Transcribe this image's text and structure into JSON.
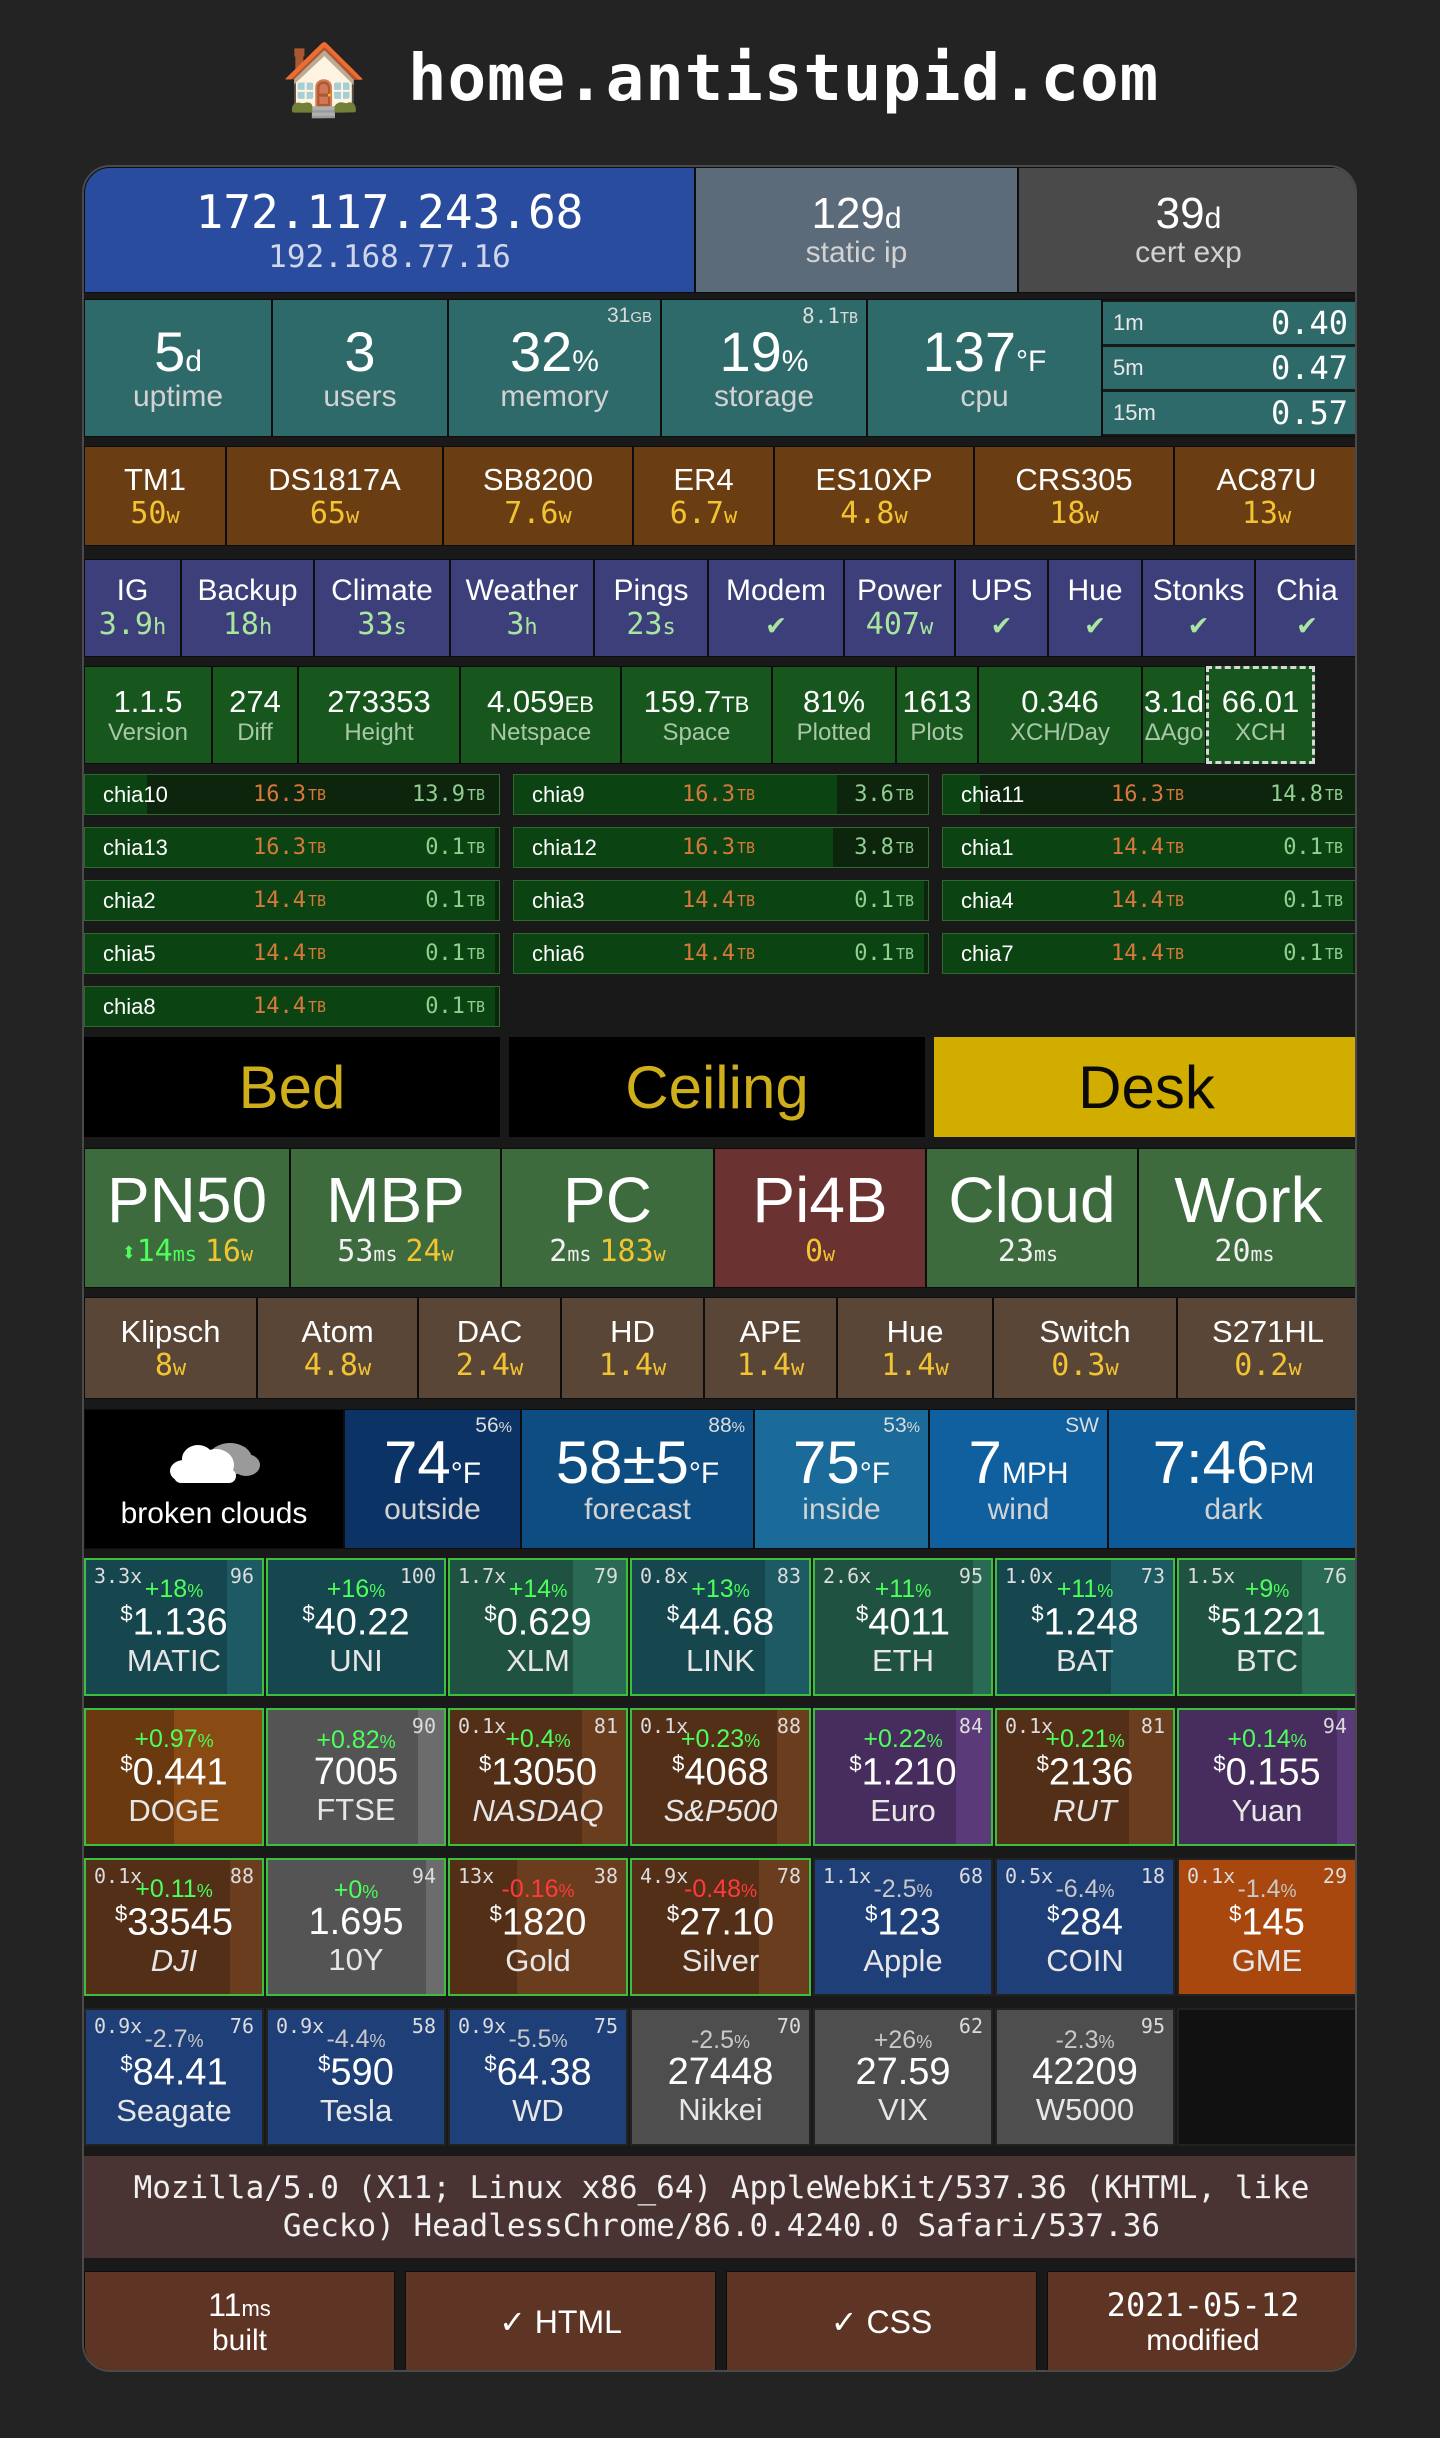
{
  "header": {
    "icon": "🏠",
    "site": "home.antistupid.com"
  },
  "network": {
    "ip_public": "172.117.243.68",
    "ip_local": "192.168.77.16",
    "static_days": "129",
    "static_unit": "d",
    "static_label": "static ip",
    "cert_days": "39",
    "cert_unit": "d",
    "cert_label": "cert exp"
  },
  "system": {
    "uptime": {
      "value": "5",
      "unit": "d",
      "label": "uptime"
    },
    "users": {
      "value": "3",
      "label": "users"
    },
    "memory": {
      "value": "32",
      "unit": "%",
      "label": "memory",
      "corner": "31",
      "corner_unit": "GB"
    },
    "storage": {
      "value": "19",
      "unit": "%",
      "label": "storage",
      "corner": "8.1",
      "corner_unit": "TB"
    },
    "cpu": {
      "value": "137",
      "unit": "°F",
      "label": "cpu"
    },
    "load": [
      {
        "period": "1m",
        "value": "0.40"
      },
      {
        "period": "5m",
        "value": "0.47"
      },
      {
        "period": "15m",
        "value": "0.57"
      }
    ]
  },
  "devices": [
    {
      "name": "TM1",
      "power": "50",
      "unit": "w"
    },
    {
      "name": "DS1817A",
      "power": "65",
      "unit": "w"
    },
    {
      "name": "SB8200",
      "power": "7.6",
      "unit": "w"
    },
    {
      "name": "ER4",
      "power": "6.7",
      "unit": "w"
    },
    {
      "name": "ES10XP",
      "power": "4.8",
      "unit": "w"
    },
    {
      "name": "CRS305",
      "power": "18",
      "unit": "w"
    },
    {
      "name": "AC87U",
      "power": "13",
      "unit": "w"
    }
  ],
  "services": [
    {
      "name": "IG",
      "value": "3.9",
      "unit": "h"
    },
    {
      "name": "Backup",
      "value": "18",
      "unit": "h"
    },
    {
      "name": "Climate",
      "value": "33",
      "unit": "s"
    },
    {
      "name": "Weather",
      "value": "3",
      "unit": "h"
    },
    {
      "name": "Pings",
      "value": "23",
      "unit": "s"
    },
    {
      "name": "Modem",
      "value": "✔",
      "unit": ""
    },
    {
      "name": "Power",
      "value": "407",
      "unit": "w"
    },
    {
      "name": "UPS",
      "value": "✔",
      "unit": ""
    },
    {
      "name": "Hue",
      "value": "✔",
      "unit": ""
    },
    {
      "name": "Stonks",
      "value": "✔",
      "unit": ""
    },
    {
      "name": "Chia",
      "value": "✔",
      "unit": ""
    }
  ],
  "chia_stats": [
    {
      "value": "1.1.5",
      "unit": "",
      "label": "Version"
    },
    {
      "value": "274",
      "unit": "",
      "label": "Diff"
    },
    {
      "value": "273353",
      "unit": "",
      "label": "Height"
    },
    {
      "value": "4.059",
      "unit": "EB",
      "label": "Netspace"
    },
    {
      "value": "159.7",
      "unit": "TB",
      "label": "Space"
    },
    {
      "value": "81%",
      "unit": "",
      "label": "Plotted"
    },
    {
      "value": "1613",
      "unit": "",
      "label": "Plots"
    },
    {
      "value": "0.346",
      "unit": "",
      "label": "XCH/Day"
    },
    {
      "value": "3.1d",
      "unit": "",
      "label": "ΔAgo"
    },
    {
      "value": "66.01",
      "unit": "",
      "label": "XCH"
    }
  ],
  "chia_nodes": [
    {
      "name": "chia10",
      "total": "16.3",
      "free": "13.9",
      "unit": "TB",
      "used_fraction": 0.15
    },
    {
      "name": "chia9",
      "total": "16.3",
      "free": "3.6",
      "unit": "TB",
      "used_fraction": 0.78
    },
    {
      "name": "chia11",
      "total": "16.3",
      "free": "14.8",
      "unit": "TB",
      "used_fraction": 0.09
    },
    {
      "name": "chia13",
      "total": "16.3",
      "free": "0.1",
      "unit": "TB",
      "used_fraction": 0.99
    },
    {
      "name": "chia12",
      "total": "16.3",
      "free": "3.8",
      "unit": "TB",
      "used_fraction": 0.77
    },
    {
      "name": "chia1",
      "total": "14.4",
      "free": "0.1",
      "unit": "TB",
      "used_fraction": 0.99
    },
    {
      "name": "chia2",
      "total": "14.4",
      "free": "0.1",
      "unit": "TB",
      "used_fraction": 0.99
    },
    {
      "name": "chia3",
      "total": "14.4",
      "free": "0.1",
      "unit": "TB",
      "used_fraction": 0.99
    },
    {
      "name": "chia4",
      "total": "14.4",
      "free": "0.1",
      "unit": "TB",
      "used_fraction": 0.99
    },
    {
      "name": "chia5",
      "total": "14.4",
      "free": "0.1",
      "unit": "TB",
      "used_fraction": 0.99
    },
    {
      "name": "chia6",
      "total": "14.4",
      "free": "0.1",
      "unit": "TB",
      "used_fraction": 0.99
    },
    {
      "name": "chia7",
      "total": "14.4",
      "free": "0.1",
      "unit": "TB",
      "used_fraction": 0.99
    },
    {
      "name": "chia8",
      "total": "14.4",
      "free": "0.1",
      "unit": "TB",
      "used_fraction": 0.99
    }
  ],
  "lights": [
    {
      "name": "Bed",
      "on": false
    },
    {
      "name": "Ceiling",
      "on": false
    },
    {
      "name": "Desk",
      "on": true
    }
  ],
  "hosts": [
    {
      "name": "PN50",
      "arrow": "⬍",
      "ping": "14",
      "power": "16",
      "color": "#3e6b3e"
    },
    {
      "name": "MBP",
      "arrow": "",
      "ping": "53",
      "power": "24",
      "color": "#3e6b3e"
    },
    {
      "name": "PC",
      "arrow": "",
      "ping": "2",
      "power": "183",
      "color": "#3e6b3e"
    },
    {
      "name": "Pi4B",
      "arrow": "",
      "ping": "",
      "power": "0",
      "color": "#6b3232"
    },
    {
      "name": "Cloud",
      "arrow": "",
      "ping": "23",
      "power": "",
      "color": "#3e6b3e"
    },
    {
      "name": "Work",
      "arrow": "",
      "ping": "20",
      "power": "",
      "color": "#3e6b3e"
    }
  ],
  "outlets": [
    {
      "name": "Klipsch",
      "power": "8",
      "unit": "w"
    },
    {
      "name": "Atom",
      "power": "4.8",
      "unit": "w"
    },
    {
      "name": "DAC",
      "power": "2.4",
      "unit": "w"
    },
    {
      "name": "HD",
      "power": "1.4",
      "unit": "w"
    },
    {
      "name": "APE",
      "power": "1.4",
      "unit": "w"
    },
    {
      "name": "Hue",
      "power": "1.4",
      "unit": "w"
    },
    {
      "name": "Switch",
      "power": "0.3",
      "unit": "w"
    },
    {
      "name": "S271HL",
      "power": "0.2",
      "unit": "w"
    }
  ],
  "weather": {
    "condition": "broken clouds",
    "outside": {
      "value": "74",
      "unit": "°F",
      "label": "outside",
      "corner": "56",
      "corner_unit": "%"
    },
    "forecast": {
      "value": "58±5",
      "unit": "°F",
      "label": "forecast",
      "corner": "88",
      "corner_unit": "%"
    },
    "inside": {
      "value": "75",
      "unit": "°F",
      "label": "inside",
      "corner": "53",
      "corner_unit": "%"
    },
    "wind": {
      "value": "7",
      "unit": "MPH",
      "label": "wind",
      "corner": "SW"
    },
    "time": {
      "value": "7:46",
      "unit": "PM",
      "label": "dark"
    }
  },
  "stocks": [
    {
      "sym": "MATIC",
      "price": "1.136",
      "cur": "$",
      "change": "+18",
      "dir": "up",
      "lev": "3.3x",
      "score": "96",
      "bg": "#1d5a64",
      "bar": 0.8,
      "italic": false
    },
    {
      "sym": "UNI",
      "price": "40.22",
      "cur": "$",
      "change": "+16",
      "dir": "up",
      "lev": "",
      "score": "100",
      "bg": "#1d5a64",
      "bar": 1,
      "italic": false
    },
    {
      "sym": "XLM",
      "price": "0.629",
      "cur": "$",
      "change": "+14",
      "dir": "up",
      "lev": "1.7x",
      "score": "79",
      "bg": "#2a6a55",
      "bar": 0.7,
      "italic": false
    },
    {
      "sym": "LINK",
      "price": "44.68",
      "cur": "$",
      "change": "+13",
      "dir": "up",
      "lev": "0.8x",
      "score": "83",
      "bg": "#1d5a64",
      "bar": 0.75,
      "italic": false
    },
    {
      "sym": "ETH",
      "price": "4011",
      "cur": "$",
      "change": "+11",
      "dir": "up",
      "lev": "2.6x",
      "score": "95",
      "bg": "#2a6a55",
      "bar": 0.9,
      "italic": false
    },
    {
      "sym": "BAT",
      "price": "1.248",
      "cur": "$",
      "change": "+11",
      "dir": "up",
      "lev": "1.0x",
      "score": "73",
      "bg": "#1d5a64",
      "bar": 0.65,
      "italic": false
    },
    {
      "sym": "BTC",
      "price": "51221",
      "cur": "$",
      "change": "+9",
      "dir": "up",
      "lev": "1.5x",
      "score": "76",
      "bg": "#2a6a55",
      "bar": 0.7,
      "italic": false
    },
    {
      "sym": "DOGE",
      "price": "0.441",
      "cur": "$",
      "change": "+0.97",
      "dir": "up",
      "lev": "",
      "score": "",
      "bg": "#8a4a14",
      "bar": 0.5,
      "italic": false
    },
    {
      "sym": "FTSE",
      "price": "7005",
      "cur": "",
      "change": "+0.82",
      "dir": "up",
      "lev": "",
      "score": "90",
      "bg": "#6c6c6c",
      "bar": 0.85,
      "italic": false
    },
    {
      "sym": "NASDAQ",
      "price": "13050",
      "cur": "$",
      "change": "+0.4",
      "dir": "up",
      "lev": "0.1x",
      "score": "81",
      "bg": "#6b3d1f",
      "bar": 0.75,
      "italic": true
    },
    {
      "sym": "S&P500",
      "price": "4068",
      "cur": "$",
      "change": "+0.23",
      "dir": "up",
      "lev": "0.1x",
      "score": "88",
      "bg": "#6b3d1f",
      "bar": 0.82,
      "italic": true
    },
    {
      "sym": "Euro",
      "price": "1.210",
      "cur": "$",
      "change": "+0.22",
      "dir": "up",
      "lev": "",
      "score": "84",
      "bg": "#5a3a78",
      "bar": 0.8,
      "italic": false
    },
    {
      "sym": "RUT",
      "price": "2136",
      "cur": "$",
      "change": "+0.21",
      "dir": "up",
      "lev": "0.1x",
      "score": "81",
      "bg": "#6b3d1f",
      "bar": 0.75,
      "italic": true
    },
    {
      "sym": "Yuan",
      "price": "0.155",
      "cur": "$",
      "change": "+0.14",
      "dir": "up",
      "lev": "",
      "score": "94",
      "bg": "#5a3a78",
      "bar": 0.9,
      "italic": false
    },
    {
      "sym": "DJI",
      "price": "33545",
      "cur": "$",
      "change": "+0.11",
      "dir": "up",
      "lev": "0.1x",
      "score": "88",
      "bg": "#6b3d1f",
      "bar": 0.82,
      "italic": true
    },
    {
      "sym": "10Y",
      "price": "1.695",
      "cur": "",
      "change": "+0",
      "dir": "up",
      "lev": "",
      "score": "94",
      "bg": "#6c6c6c",
      "bar": 0.9,
      "italic": false
    },
    {
      "sym": "Gold",
      "price": "1820",
      "cur": "$",
      "change": "-0.16",
      "dir": "down",
      "lev": "13x",
      "score": "38",
      "bg": "#6b3d1f",
      "bar": 0.38,
      "italic": false
    },
    {
      "sym": "Silver",
      "price": "27.10",
      "cur": "$",
      "change": "-0.48",
      "dir": "down",
      "lev": "4.9x",
      "score": "78",
      "bg": "#6b3d1f",
      "bar": 0.72,
      "italic": false
    },
    {
      "sym": "Apple",
      "price": "123",
      "cur": "$",
      "change": "-2.5",
      "dir": "flat",
      "lev": "1.1x",
      "score": "68",
      "bg": "#1e3f78",
      "bar": 0,
      "italic": false
    },
    {
      "sym": "COIN",
      "price": "284",
      "cur": "$",
      "change": "-6.4",
      "dir": "flat",
      "lev": "0.5x",
      "score": "18",
      "bg": "#1e3f78",
      "bar": 0,
      "italic": false
    },
    {
      "sym": "GME",
      "price": "145",
      "cur": "$",
      "change": "-1.4",
      "dir": "flat",
      "lev": "0.1x",
      "score": "29",
      "bg": "#a8480e",
      "bar": 0,
      "italic": false
    },
    {
      "sym": "Seagate",
      "price": "84.41",
      "cur": "$",
      "change": "-2.7",
      "dir": "flat",
      "lev": "0.9x",
      "score": "76",
      "bg": "#1e3f78",
      "bar": 0,
      "italic": false
    },
    {
      "sym": "Tesla",
      "price": "590",
      "cur": "$",
      "change": "-4.4",
      "dir": "flat",
      "lev": "0.9x",
      "score": "58",
      "bg": "#1e3f78",
      "bar": 0,
      "italic": false
    },
    {
      "sym": "WD",
      "price": "64.38",
      "cur": "$",
      "change": "-5.5",
      "dir": "flat",
      "lev": "0.9x",
      "score": "75",
      "bg": "#1e3f78",
      "bar": 0,
      "italic": false
    },
    {
      "sym": "Nikkei",
      "price": "27448",
      "cur": "",
      "change": "-2.5",
      "dir": "flat",
      "lev": "",
      "score": "70",
      "bg": "#4e4e4e",
      "bar": 0,
      "italic": false
    },
    {
      "sym": "VIX",
      "price": "27.59",
      "cur": "",
      "change": "+26",
      "dir": "flat",
      "lev": "",
      "score": "62",
      "bg": "#4e4e4e",
      "bar": 0,
      "italic": false
    },
    {
      "sym": "W5000",
      "price": "42209",
      "cur": "",
      "change": "-2.3",
      "dir": "flat",
      "lev": "",
      "score": "95",
      "bg": "#4e4e4e",
      "bar": 0,
      "italic": false
    }
  ],
  "useragent": "Mozilla/5.0 (X11; Linux x86_64) AppleWebKit/537.36 (KHTML, like Gecko) HeadlessChrome/86.0.4240.0 Safari/537.36",
  "footer": {
    "built_value": "11",
    "built_unit": "ms",
    "built_label": "built",
    "html": "✓ HTML",
    "css": "✓ CSS",
    "modified_date": "2021-05-12",
    "modified_label": "modified"
  }
}
